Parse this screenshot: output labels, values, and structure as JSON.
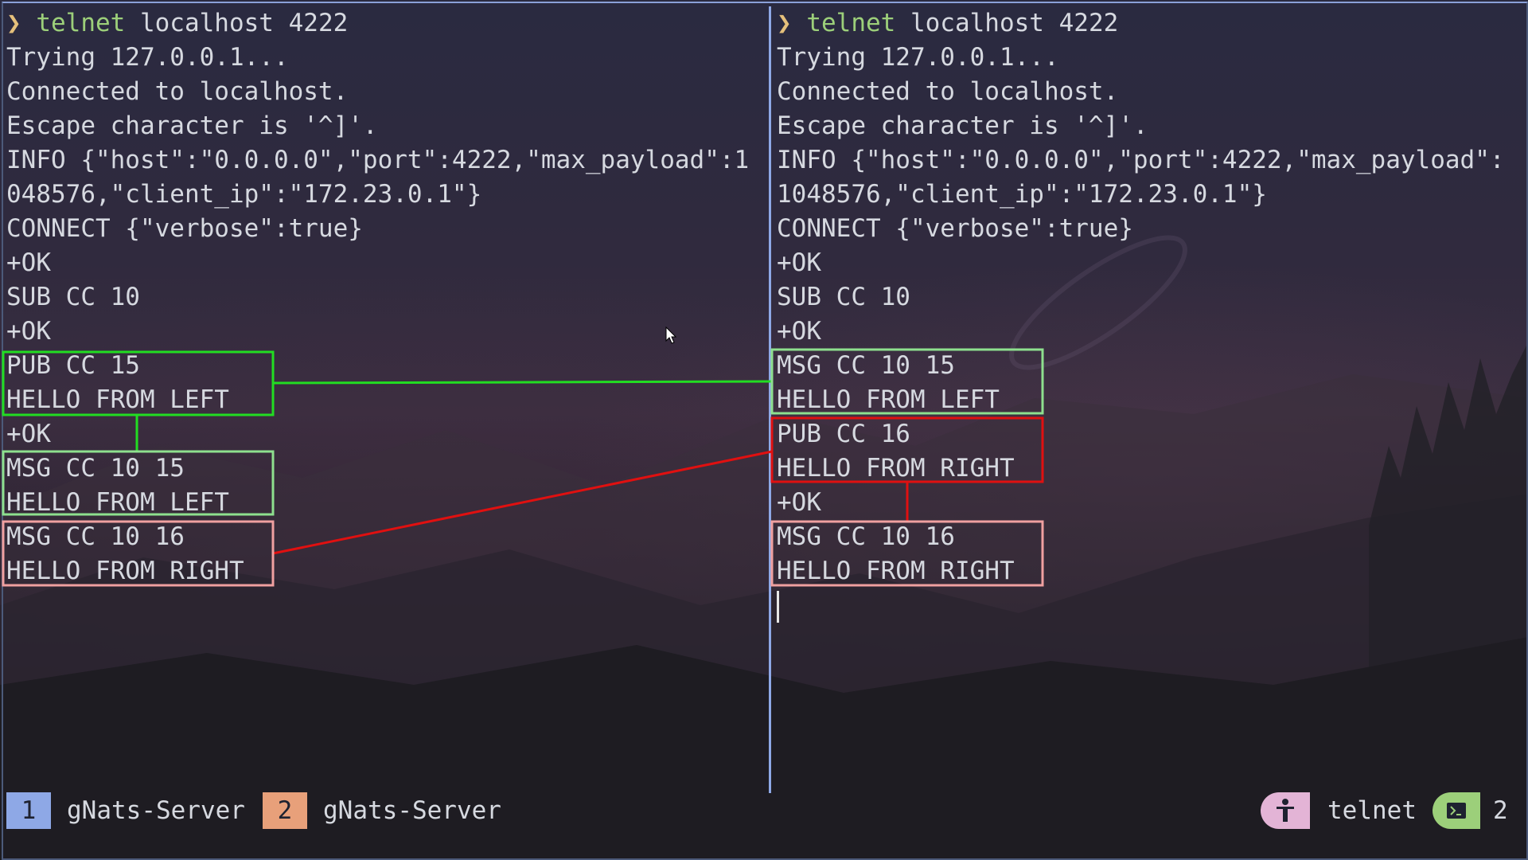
{
  "left_pane": {
    "lines": [
      "❯ telnet localhost 4222",
      "Trying 127.0.0.1...",
      "Connected to localhost.",
      "Escape character is '^]'.",
      "INFO {\"host\":\"0.0.0.0\",\"port\":4222,\"max_payload\":1",
      "048576,\"client_ip\":\"172.23.0.1\"}",
      "CONNECT {\"verbose\":true}",
      "+OK",
      "SUB CC 10",
      "+OK",
      "PUB CC 15",
      "HELLO FROM LEFT",
      "+OK",
      "MSG CC 10 15",
      "HELLO FROM LEFT",
      "MSG CC 10 16",
      "HELLO FROM RIGHT"
    ]
  },
  "right_pane": {
    "lines": [
      "❯ telnet localhost 4222",
      "Trying 127.0.0.1...",
      "Connected to localhost.",
      "Escape character is '^]'.",
      "INFO {\"host\":\"0.0.0.0\",\"port\":4222,\"max_payload\":",
      "1048576,\"client_ip\":\"172.23.0.1\"}",
      "CONNECT {\"verbose\":true}",
      "+OK",
      "SUB CC 10",
      "+OK",
      "MSG CC 10 15",
      "HELLO FROM LEFT",
      "PUB CC 16",
      "HELLO FROM RIGHT",
      "+OK",
      "MSG CC 10 16",
      "HELLO FROM RIGHT"
    ]
  },
  "statusbar": {
    "tab1_number": "1",
    "tab1_name": "gNats-Server",
    "tab2_number": "2",
    "tab2_name": "gNats-Server",
    "process_name": "telnet",
    "window_count": "2"
  },
  "colors": {
    "green_annotation": "#22dd22",
    "light_green_box": "#8ee08e",
    "red_annotation": "#e01010",
    "pink_box": "#f0a0a0",
    "active_divider": "#8ea8e6",
    "tab1_accent": "#8ea8e6",
    "tab2_accent": "#e8a07a",
    "process_accent": "#e3b4d6",
    "window_accent": "#9ccf7a"
  },
  "icons": {
    "process": "person-icon",
    "window": "terminal-icon"
  }
}
